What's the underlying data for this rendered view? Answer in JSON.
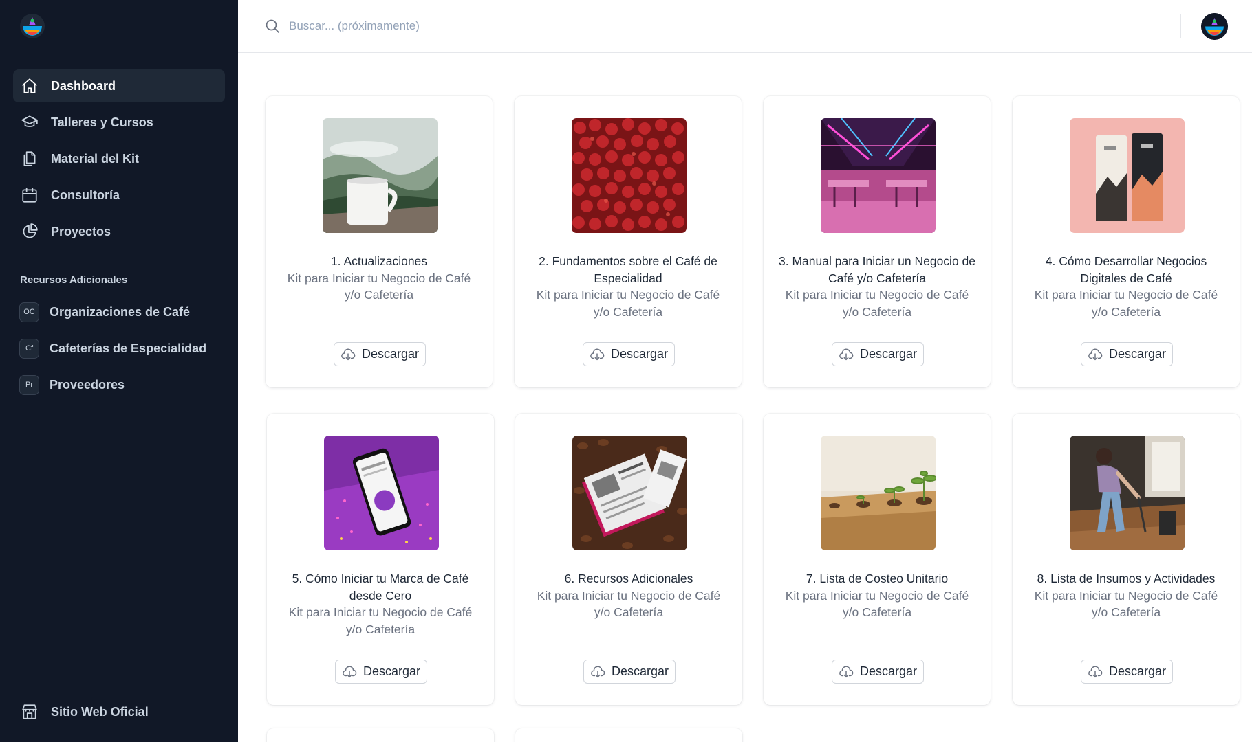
{
  "sidebar": {
    "items": [
      {
        "label": "Dashboard",
        "icon": "home-icon",
        "active": true
      },
      {
        "label": "Talleres y Cursos",
        "icon": "graduation-cap-icon"
      },
      {
        "label": "Material del Kit",
        "icon": "documents-icon"
      },
      {
        "label": "Consultoría",
        "icon": "calendar-icon"
      },
      {
        "label": "Proyectos",
        "icon": "pie-chart-icon"
      }
    ],
    "section_title": "Recursos Adicionales",
    "resources": [
      {
        "badge": "OC",
        "label": "Organizaciones de Café"
      },
      {
        "badge": "Cf",
        "label": "Cafeterías de Especialidad"
      },
      {
        "badge": "Pr",
        "label": "Proveedores"
      }
    ],
    "bottom": {
      "label": "Sitio Web Oficial",
      "icon": "store-icon"
    }
  },
  "search": {
    "placeholder": "Buscar... (próximamente)"
  },
  "cards": [
    {
      "title": "1. Actualizaciones",
      "subtitle": "Kit para Iniciar tu Negocio de Café y/o Cafetería",
      "button": "Descargar"
    },
    {
      "title": "2. Fundamentos sobre el Café de Especialidad",
      "subtitle": "Kit para Iniciar tu Negocio de Café y/o Cafetería",
      "button": "Descargar"
    },
    {
      "title": "3. Manual para Iniciar un Negocio de Café y/o Cafetería",
      "subtitle": "Kit para Iniciar tu Negocio de Café y/o Cafetería",
      "button": "Descargar"
    },
    {
      "title": "4. Cómo Desarrollar Negocios Digitales de Café",
      "subtitle": "Kit para Iniciar tu Negocio de Café y/o Cafetería",
      "button": "Descargar"
    },
    {
      "title": "5. Cómo Iniciar tu Marca de Café desde Cero",
      "subtitle": "Kit para Iniciar tu Negocio de Café y/o Cafetería",
      "button": "Descargar"
    },
    {
      "title": "6. Recursos Adicionales",
      "subtitle": "Kit para Iniciar tu Negocio de Café y/o Cafetería",
      "button": "Descargar"
    },
    {
      "title": "7. Lista de Costeo Unitario",
      "subtitle": "Kit para Iniciar tu Negocio de Café y/o Cafetería",
      "button": "Descargar"
    },
    {
      "title": "8. Lista de Insumos y Actividades",
      "subtitle": "Kit para Iniciar tu Negocio de Café y/o Cafetería",
      "button": "Descargar"
    }
  ],
  "colors": {
    "sidebar_bg": "#111827",
    "active_bg": "#1f2937",
    "text_muted": "#6b7280"
  }
}
